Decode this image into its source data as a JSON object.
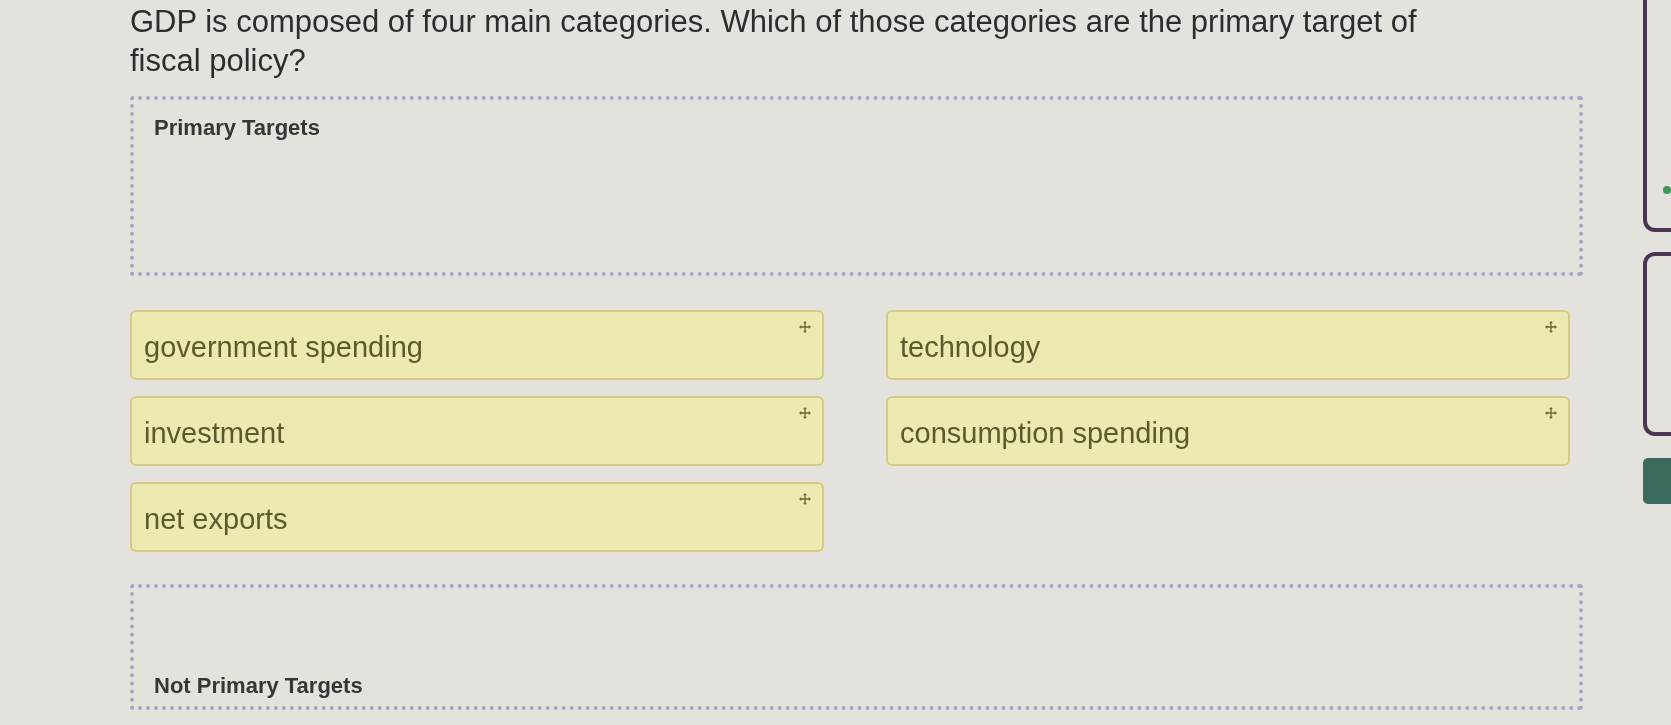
{
  "question": "GDP is composed of four main categories. Which of those categories are the primary target of fiscal policy?",
  "primary_zone": {
    "label": "Primary Targets"
  },
  "answer_cards": [
    {
      "label": "government spending"
    },
    {
      "label": "technology"
    },
    {
      "label": "investment"
    },
    {
      "label": "consumption spending"
    },
    {
      "label": "net exports"
    }
  ],
  "secondary_zone": {
    "label": "Not Primary Targets"
  }
}
